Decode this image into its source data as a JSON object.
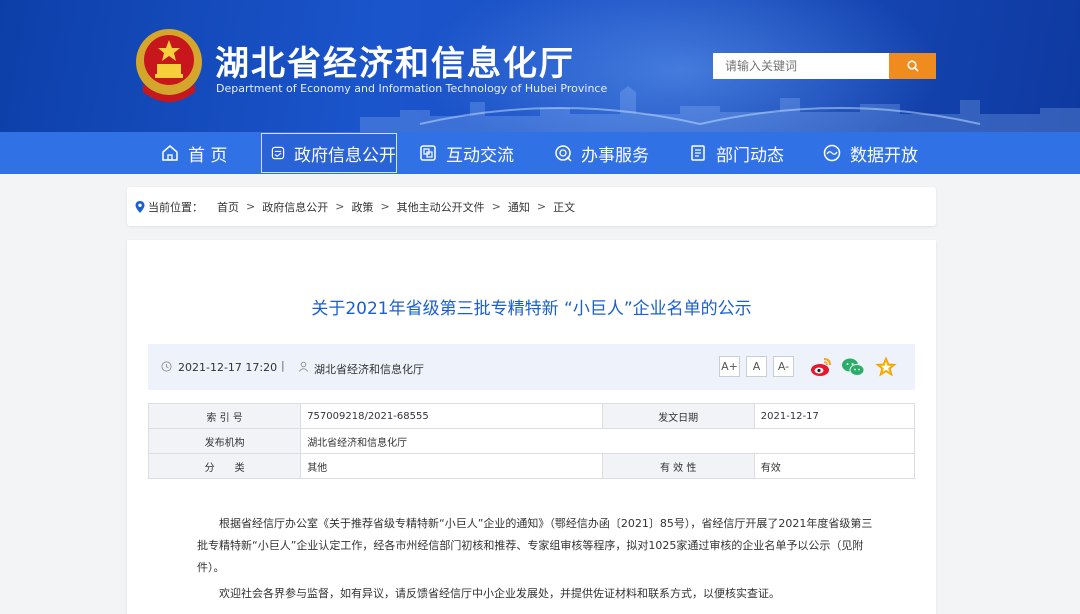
{
  "header": {
    "title": "湖北省经济和信息化厅",
    "subtitle": "Department of Economy and Information Technology of Hubei Province",
    "search_placeholder": "请输入关键词"
  },
  "nav": {
    "items": [
      {
        "label": "首 页",
        "icon": "home-icon"
      },
      {
        "label": "政府信息公开",
        "icon": "document-icon",
        "active": true
      },
      {
        "label": "互动交流",
        "icon": "chat-icon"
      },
      {
        "label": "办事服务",
        "icon": "service-icon"
      },
      {
        "label": "部门动态",
        "icon": "news-icon"
      },
      {
        "label": "数据开放",
        "icon": "data-icon"
      }
    ]
  },
  "breadcrumb": {
    "prefix": "当前位置：",
    "items": [
      "首页",
      "政府信息公开",
      "政策",
      "其他主动公开文件",
      "通知",
      "正文"
    ],
    "separator": ">"
  },
  "article": {
    "title": "关于2021年省级第三批专精特新 “小巨人”企业名单的公示",
    "datetime": "2021-12-17 17:20",
    "divider": "|",
    "source": "湖北省经济和信息化厅",
    "font_buttons": [
      "A+",
      "A",
      "A-"
    ],
    "info_table": {
      "index_label": "索 引 号",
      "index_value": "757009218/2021-68555",
      "date_label": "发文日期",
      "date_value": "2021-12-17",
      "org_label": "发布机构",
      "org_value": "湖北省经济和信息化厅",
      "category_label": "分　　类",
      "category_value": "其他",
      "validity_label": "有 效 性",
      "validity_value": "有效"
    },
    "paragraphs": [
      "根据省经信厅办公室《关于推荐省级专精特新“小巨人”企业的通知》（鄂经信办函〔2021〕85号），省经信厅开展了2021年度省级第三批专精特新“小巨人”企业认定工作，经各市州经信部门初核和推荐、专家组审核等程序，拟对1025家通过审核的企业名单予以公示（见附件）。",
      "欢迎社会各界参与监督，如有异议，请反馈省经信厅中小企业发展处，并提供佐证材料和联系方式，以便核实查证。"
    ]
  },
  "colors": {
    "banner": "#1b55cc",
    "nav": "#3171e6",
    "title": "#1a5fd0",
    "search_button": "#f08c1e"
  }
}
